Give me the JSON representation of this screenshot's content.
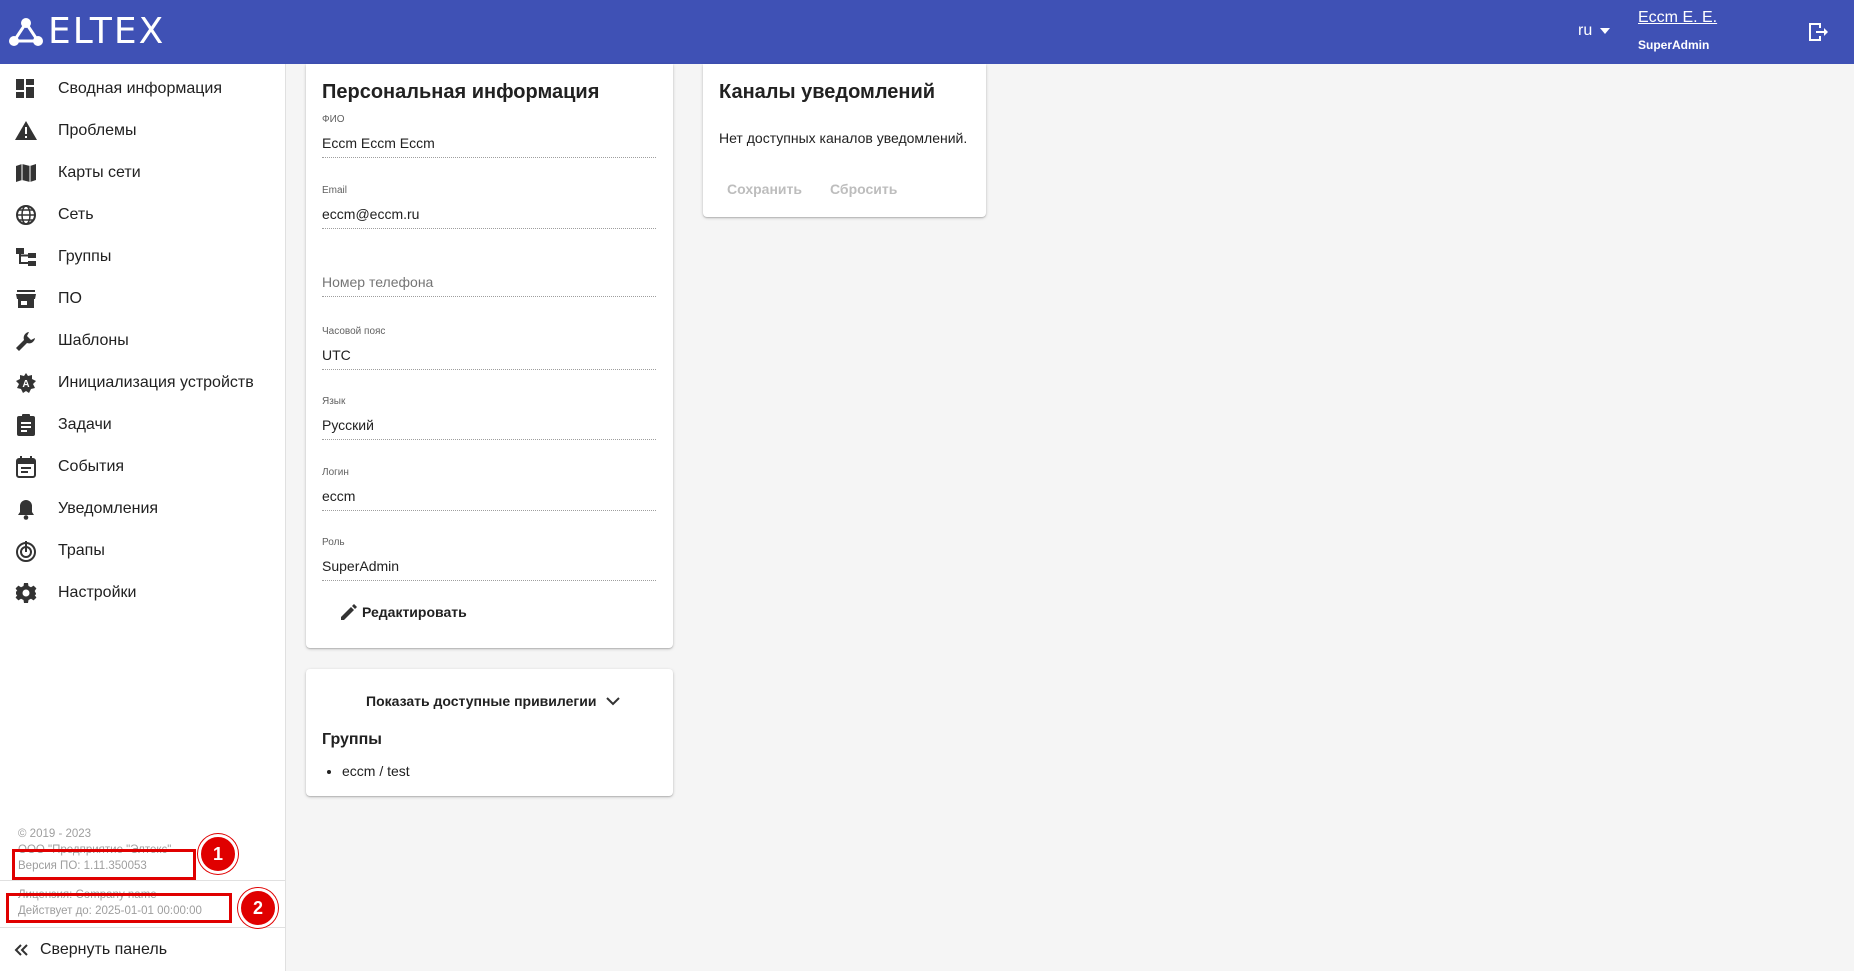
{
  "header": {
    "logo_text": "ELTEX",
    "lang": "ru",
    "user_name": "Eccm E. E.",
    "user_role": "SuperAdmin"
  },
  "colors": {
    "header_bg": "#3f51b5",
    "callout": "#e00000"
  },
  "sidebar": {
    "items": [
      {
        "label": "Сводная информация",
        "icon": "dashboard-icon"
      },
      {
        "label": "Проблемы",
        "icon": "warning-icon"
      },
      {
        "label": "Карты сети",
        "icon": "map-icon"
      },
      {
        "label": "Сеть",
        "icon": "globe-icon"
      },
      {
        "label": "Группы",
        "icon": "groups-tree-icon"
      },
      {
        "label": "ПО",
        "icon": "store-icon"
      },
      {
        "label": "Шаблоны",
        "icon": "wrench-icon"
      },
      {
        "label": "Инициализация устройств",
        "icon": "auto-init-icon"
      },
      {
        "label": "Задачи",
        "icon": "clipboard-icon"
      },
      {
        "label": "События",
        "icon": "calendar-icon"
      },
      {
        "label": "Уведомления",
        "icon": "bell-icon"
      },
      {
        "label": "Трапы",
        "icon": "trap-icon"
      },
      {
        "label": "Настройки",
        "icon": "gear-icon"
      }
    ],
    "footer": {
      "copyright": "© 2019 - 2023",
      "company": "ООО \"Предприятие \"Элтекс\"",
      "version": "Версия ПО: 1.11.350053",
      "license": "Лицензия: Company name",
      "valid_until": "Действует до: 2025-01-01 00:00:00"
    },
    "collapse_label": "Свернуть панель"
  },
  "callouts": [
    "1",
    "2"
  ],
  "personal": {
    "title": "Персональная информация",
    "fields": [
      {
        "label": "ФИО",
        "value": "Eccm Eccm Eccm"
      },
      {
        "label": "Email",
        "value": "eccm@eccm.ru"
      },
      {
        "label": "",
        "placeholder": "Номер телефона"
      },
      {
        "label": "Часовой пояс",
        "value": "UTC"
      },
      {
        "label": "Язык",
        "value": "Русский"
      },
      {
        "label": "Логин",
        "value": "eccm"
      },
      {
        "label": "Роль",
        "value": "SuperAdmin"
      }
    ],
    "edit_label": "Редактировать"
  },
  "privileges": {
    "toggle_label": "Показать доступные привилегии",
    "groups_title": "Группы",
    "groups": [
      "eccm / test"
    ]
  },
  "notifications": {
    "title": "Каналы уведомлений",
    "empty_text": "Нет доступных каналов уведомлений.",
    "save_label": "Сохранить",
    "reset_label": "Сбросить"
  }
}
